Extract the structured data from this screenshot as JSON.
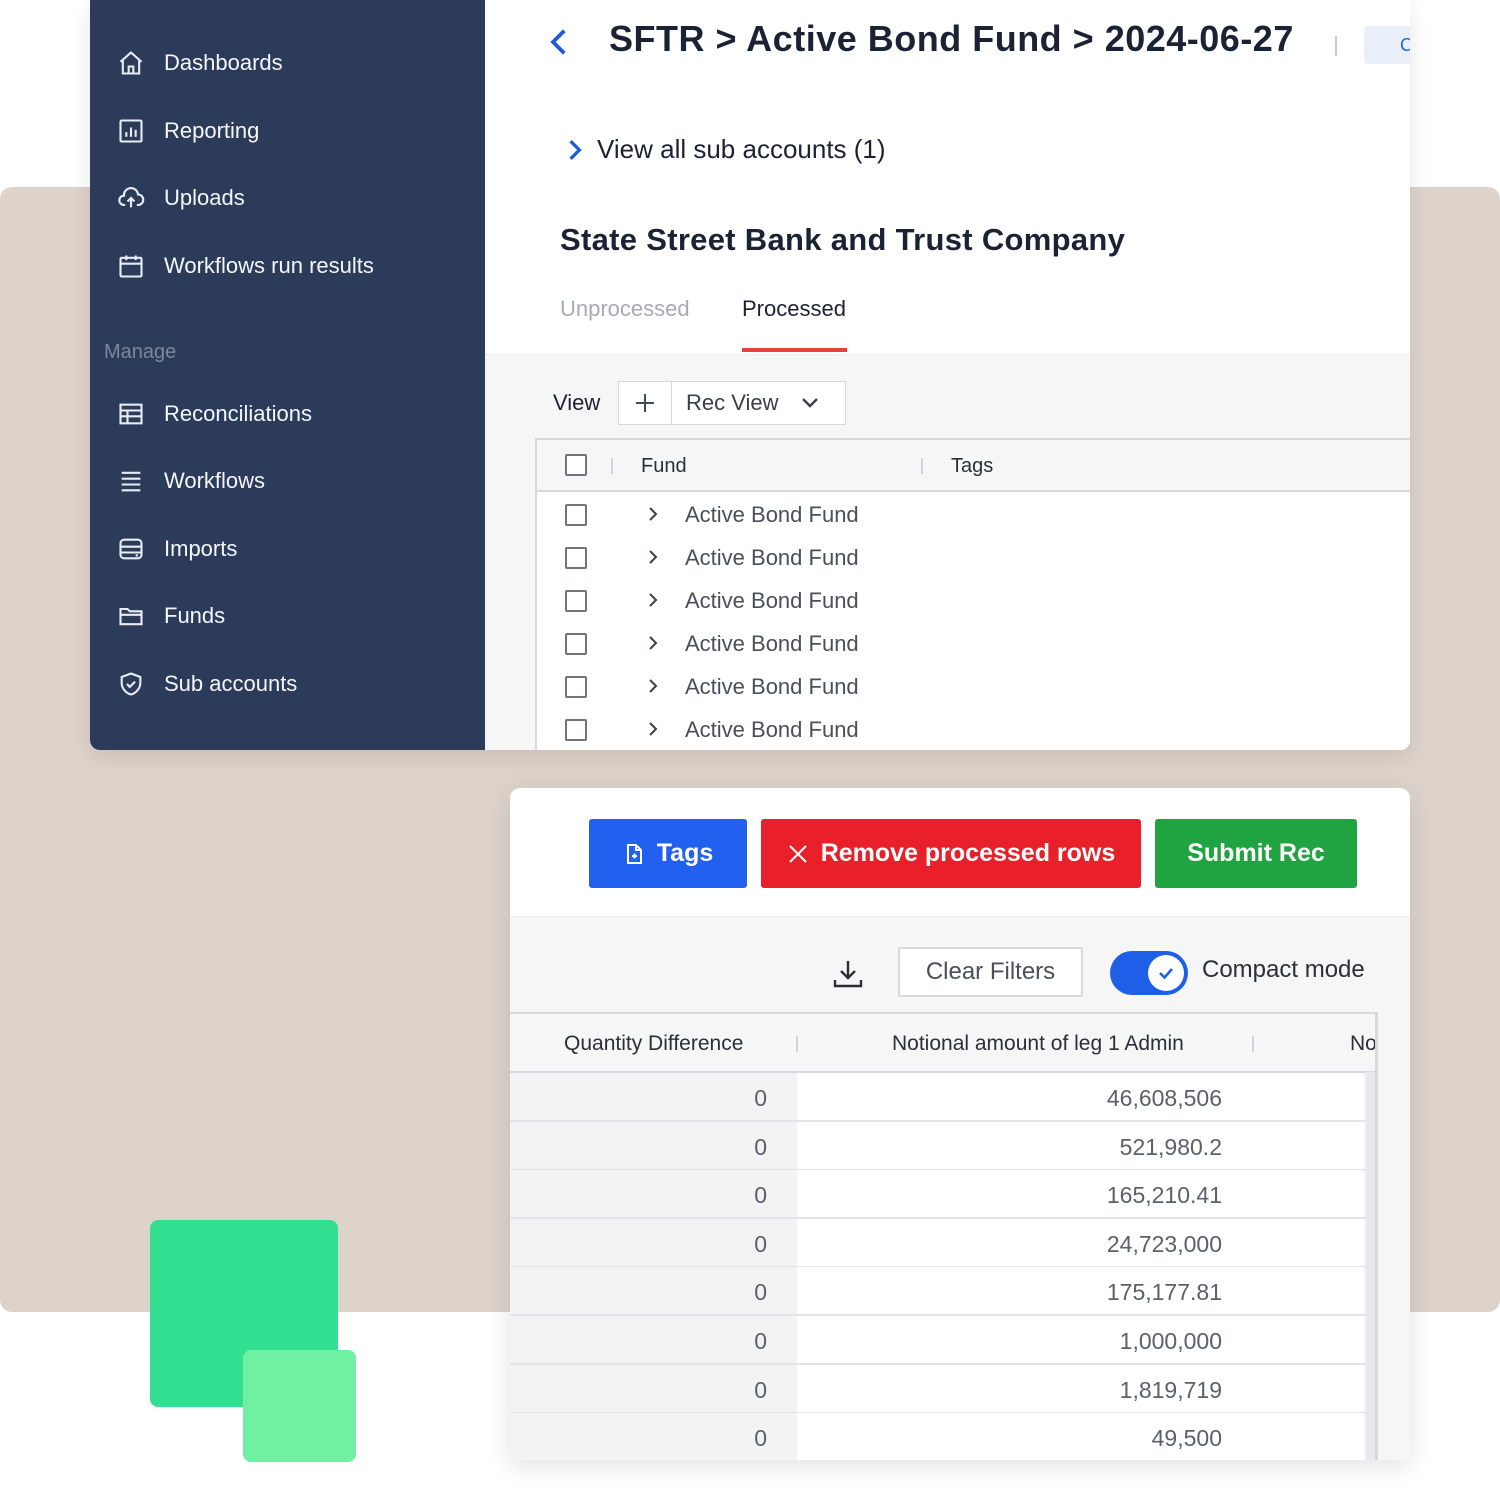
{
  "sidebar": {
    "items": [
      {
        "label": "Dashboards",
        "icon": "home-icon"
      },
      {
        "label": "Reporting",
        "icon": "bar-chart-icon"
      },
      {
        "label": "Uploads",
        "icon": "cloud-upload-icon"
      },
      {
        "label": "Workflows run results",
        "icon": "calendar-icon"
      }
    ],
    "section_label": "Manage",
    "manage_items": [
      {
        "label": "Reconciliations",
        "icon": "table-icon"
      },
      {
        "label": "Workflows",
        "icon": "list-icon"
      },
      {
        "label": "Imports",
        "icon": "database-icon"
      },
      {
        "label": "Funds",
        "icon": "folder-icon"
      },
      {
        "label": "Sub accounts",
        "icon": "shield-check-icon"
      }
    ]
  },
  "header": {
    "breadcrumb": "SFTR > Active Bond Fund > 2024-06-27",
    "pill_text": "C"
  },
  "sub_accounts_link": "View all sub accounts (1)",
  "company_title": "State Street Bank and Trust Company",
  "tabs": {
    "unprocessed": "Unprocessed",
    "processed": "Processed",
    "active": "processed"
  },
  "view_bar": {
    "label": "View",
    "selected_view": "Rec View"
  },
  "fund_table": {
    "columns": [
      "Fund",
      "Tags"
    ],
    "rows": [
      "Active Bond Fund",
      "Active Bond Fund",
      "Active Bond Fund",
      "Active Bond Fund",
      "Active Bond Fund",
      "Active Bond Fund"
    ]
  },
  "actions": {
    "tags": "Tags",
    "remove": "Remove processed rows",
    "submit": "Submit Rec"
  },
  "toolbar": {
    "clear_filters": "Clear Filters",
    "compact_mode_label": "Compact mode",
    "compact_mode_on": true
  },
  "qty_table": {
    "columns": [
      "Quantity Difference",
      "Notional amount of leg 1 Admin",
      "No"
    ],
    "rows": [
      [
        "0",
        "46,608,506"
      ],
      [
        "0",
        "521,980.2"
      ],
      [
        "0",
        "165,210.41"
      ],
      [
        "0",
        "24,723,000"
      ],
      [
        "0",
        "175,177.81"
      ],
      [
        "0",
        "1,000,000"
      ],
      [
        "0",
        "1,819,719"
      ],
      [
        "0",
        "49,500"
      ]
    ]
  },
  "colors": {
    "sidebar_bg": "#2d3b5a",
    "accent_blue": "#2260f0",
    "danger_red": "#e9202a",
    "success_green": "#1fa441",
    "tab_underline": "#e8413b",
    "background_beige": "#ddd3ca",
    "decor_green": "#33e091",
    "decor_green_light": "#6ff0a2"
  }
}
